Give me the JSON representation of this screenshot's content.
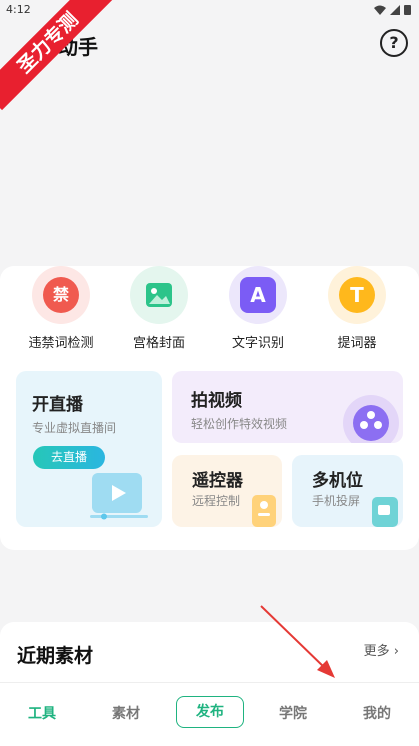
{
  "status_bar": {
    "time": "4:12"
  },
  "header": {
    "title": "动手",
    "help_label": "?"
  },
  "ribbon": {
    "text": "圣力专测"
  },
  "tools": [
    {
      "label": "违禁词检测",
      "glyph": "禁"
    },
    {
      "label": "宫格封面",
      "glyph": ""
    },
    {
      "label": "文字识别",
      "glyph": "A"
    },
    {
      "label": "提词器",
      "glyph": "T"
    }
  ],
  "features": {
    "live": {
      "title": "开直播",
      "subtitle": "专业虚拟直播间",
      "button": "去直播"
    },
    "shoot": {
      "title": "拍视频",
      "subtitle": "轻松创作特效视频"
    },
    "remote": {
      "title": "遥控器",
      "subtitle": "远程控制"
    },
    "multi": {
      "title": "多机位",
      "subtitle": "手机投屏"
    }
  },
  "recent": {
    "title": "近期素材",
    "more": "更多"
  },
  "tabbar": [
    "工具",
    "素材",
    "发布",
    "学院",
    "我的"
  ],
  "colors": {
    "accent": "#1fb380",
    "ribbon": "#e8202f",
    "arrow": "#e53935"
  }
}
